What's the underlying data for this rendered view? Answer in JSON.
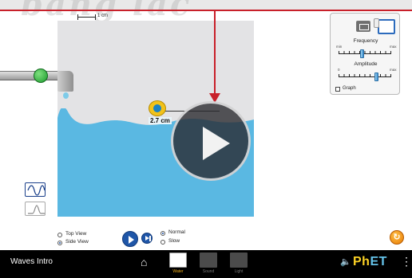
{
  "watermark": {
    "text": "bang lac"
  },
  "scale_bar": {
    "label": "1 cm"
  },
  "measuring_tape": {
    "readout": "2.7 cm"
  },
  "panel": {
    "frequency": {
      "title": "Frequency",
      "min": "min",
      "max": "max",
      "value": 0.45
    },
    "amplitude": {
      "title": "Amplitude",
      "min": "0",
      "max": "max",
      "value": 0.72
    },
    "graph": {
      "label": "Graph",
      "checked": false
    }
  },
  "wave_types": [
    {
      "icon": "sine-wave-icon",
      "selected": true
    },
    {
      "icon": "pulse-wave-icon",
      "selected": false
    }
  ],
  "view_options": [
    {
      "label": "Top View",
      "selected": false
    },
    {
      "label": "Side View",
      "selected": true
    }
  ],
  "speed_options": [
    {
      "label": "Normal",
      "selected": true
    },
    {
      "label": "Slow",
      "selected": false
    }
  ],
  "navbar": {
    "sim_title": "Waves Intro",
    "screens": [
      {
        "label": "Water",
        "active": true
      },
      {
        "label": "Sound",
        "active": false
      },
      {
        "label": "Light",
        "active": false
      }
    ],
    "logo": {
      "ph": "Ph",
      "et": "ET"
    }
  },
  "colors": {
    "water": "#5ab8e2",
    "water_dark": "#4aa9d6",
    "sim_background": "#e3e3e5",
    "annotation_red": "#c8202a",
    "navbar": "#000000",
    "active_tab": "#f2b01c"
  }
}
